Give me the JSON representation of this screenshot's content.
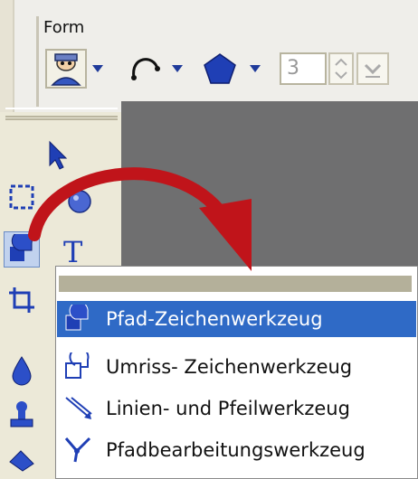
{
  "form_group": {
    "label": "Form",
    "sides_value": "3"
  },
  "menu": {
    "items": [
      {
        "label": "Pfad-Zeichenwerkzeug",
        "selected": true,
        "icon": "filled-shape-icon"
      },
      {
        "label": "Umriss- Zeichenwerkzeug",
        "selected": false,
        "icon": "outline-shape-icon"
      },
      {
        "label": "Linien- und Pfeilwerkzeug",
        "selected": false,
        "icon": "line-arrow-icon"
      },
      {
        "label": "Pfadbearbeitungswerkzeug",
        "selected": false,
        "icon": "path-edit-icon"
      }
    ]
  },
  "colors": {
    "selection": "#2f6ac6",
    "canvas": "#6f6f70",
    "accent_arrow": "#c0141a"
  },
  "toolbox": {
    "tools": [
      "select-arrow-icon",
      "crop-select-icon",
      "sphere-icon",
      "shape-draw-icon",
      "text-tool-icon",
      "crop-icon",
      "fill-drop-icon",
      "stamp-icon",
      "eraser-icon"
    ]
  }
}
